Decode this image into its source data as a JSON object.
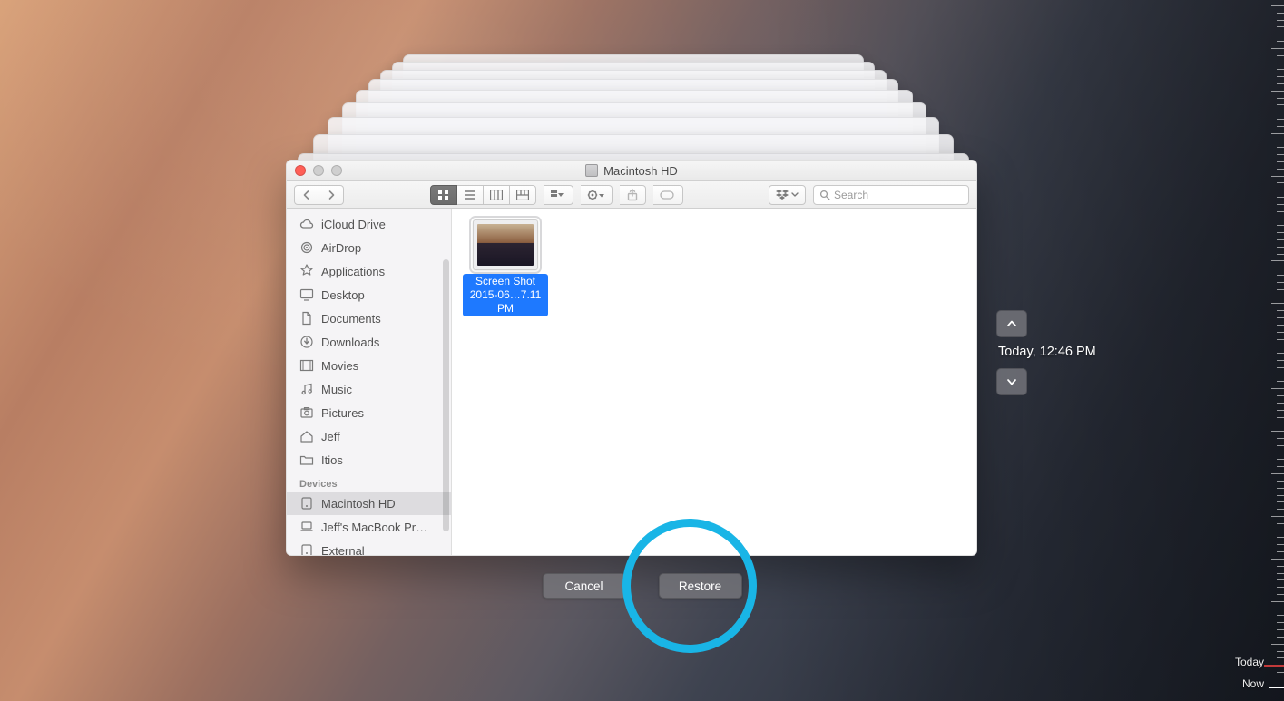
{
  "window": {
    "title": "Macintosh HD",
    "search_placeholder": "Search"
  },
  "sidebar": {
    "favorites": [
      {
        "icon": "cloud-icon",
        "label": "iCloud Drive"
      },
      {
        "icon": "airdrop-icon",
        "label": "AirDrop"
      },
      {
        "icon": "apps-icon",
        "label": "Applications"
      },
      {
        "icon": "desktop-icon",
        "label": "Desktop"
      },
      {
        "icon": "documents-icon",
        "label": "Documents"
      },
      {
        "icon": "downloads-icon",
        "label": "Downloads"
      },
      {
        "icon": "movies-icon",
        "label": "Movies"
      },
      {
        "icon": "music-icon",
        "label": "Music"
      },
      {
        "icon": "pictures-icon",
        "label": "Pictures"
      },
      {
        "icon": "house-icon",
        "label": "Jeff"
      },
      {
        "icon": "folder-icon",
        "label": "Itios"
      }
    ],
    "devices_header": "Devices",
    "devices": [
      {
        "icon": "hdd-icon",
        "label": "Macintosh HD",
        "selected": true
      },
      {
        "icon": "laptop-icon",
        "label": "Jeff's MacBook Pr…"
      },
      {
        "icon": "hdd-icon",
        "label": "External"
      }
    ]
  },
  "files": [
    {
      "name_line1": "Screen Shot",
      "name_line2": "2015-06…7.11 PM",
      "selected": true
    }
  ],
  "actions": {
    "cancel": "Cancel",
    "restore": "Restore"
  },
  "timeline": {
    "current_label": "Today, 12:46 PM",
    "ruler_today": "Today",
    "ruler_now": "Now"
  }
}
